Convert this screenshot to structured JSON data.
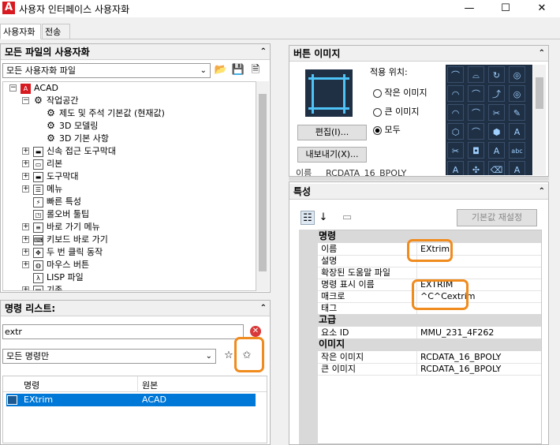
{
  "window": {
    "title": "사용자 인터페이스 사용자화",
    "logo": "A",
    "min": "—",
    "max": "☐",
    "close": "✕"
  },
  "tabs": [
    "사용자화",
    "전송"
  ],
  "all_files": {
    "header": "모든 파일의 사용자화",
    "dropdown": "모든 사용자화 파일",
    "tree": [
      {
        "label": "ACAD",
        "indent": 0,
        "icon": "acad-icon",
        "exp": "⊟"
      },
      {
        "label": "작업공간",
        "indent": 1,
        "icon": "gear-icon",
        "exp": "⊟"
      },
      {
        "label": "제도 및 주석 기본값 (현재값)",
        "indent": 2,
        "icon": "gear-icon",
        "exp": ""
      },
      {
        "label": "3D 모델링",
        "indent": 2,
        "icon": "gear-icon",
        "exp": ""
      },
      {
        "label": "3D 기본 사항",
        "indent": 2,
        "icon": "gear-icon",
        "exp": ""
      },
      {
        "label": "신속 접근 도구막대",
        "indent": 1,
        "icon": "toolbar-icon",
        "exp": "⊞"
      },
      {
        "label": "리본",
        "indent": 1,
        "icon": "ribbon-icon",
        "exp": "⊞"
      },
      {
        "label": "도구막대",
        "indent": 1,
        "icon": "toolbar-icon",
        "exp": "⊞"
      },
      {
        "label": "메뉴",
        "indent": 1,
        "icon": "menu-icon",
        "exp": "⊞"
      },
      {
        "label": "빠른 특성",
        "indent": 1,
        "icon": "quick-props-icon",
        "exp": ""
      },
      {
        "label": "롤오버 툴팁",
        "indent": 1,
        "icon": "tooltip-icon",
        "exp": ""
      },
      {
        "label": "바로 가기 메뉴",
        "indent": 1,
        "icon": "shortcut-menu-icon",
        "exp": "⊞"
      },
      {
        "label": "키보드 바로 가기",
        "indent": 1,
        "icon": "keyboard-icon",
        "exp": "⊞"
      },
      {
        "label": "두 번 클릭 동작",
        "indent": 1,
        "icon": "double-click-icon",
        "exp": "⊞"
      },
      {
        "label": "마우스 버튼",
        "indent": 1,
        "icon": "mouse-icon",
        "exp": "⊞"
      },
      {
        "label": "LISP 파일",
        "indent": 1,
        "icon": "lisp-icon",
        "exp": ""
      },
      {
        "label": "기존",
        "indent": 1,
        "icon": "legacy-icon",
        "exp": "⊞"
      }
    ]
  },
  "command_list": {
    "header": "명령 리스트:",
    "search_value": "extr",
    "filter": "모든 명령만",
    "columns": [
      "명령",
      "원본"
    ],
    "rows": [
      {
        "command": "EXtrim",
        "source": "ACAD"
      }
    ]
  },
  "button_image": {
    "header": "버튼 이미지",
    "apply_to": "적용 위치:",
    "options": [
      "작은 이미지",
      "큰 이미지",
      "모두"
    ],
    "selected": "모두",
    "edit": "편집(I)...",
    "export": "내보내기(X)...",
    "cutoff_label": "이름",
    "cutoff_value": "RCDATA_16_BPOLY"
  },
  "properties": {
    "header": "특성",
    "reset": "기본값 재설정",
    "categories": [
      {
        "name": "명령",
        "rows": [
          {
            "k": "이름",
            "v": "EXtrim"
          },
          {
            "k": "설명",
            "v": ""
          },
          {
            "k": "확장된 도움말 파일",
            "v": ""
          },
          {
            "k": "명령 표시 이름",
            "v": "EXTRIM"
          },
          {
            "k": "매크로",
            "v": "^C^Cextrim"
          },
          {
            "k": "태그",
            "v": ""
          }
        ]
      },
      {
        "name": "고급",
        "rows": [
          {
            "k": "요소 ID",
            "v": "MMU_231_4F262"
          }
        ]
      },
      {
        "name": "이미지",
        "rows": [
          {
            "k": "작은 이미지",
            "v": "RCDATA_16_BPOLY"
          },
          {
            "k": "큰 이미지",
            "v": "RCDATA_16_BPOLY"
          }
        ]
      }
    ]
  },
  "colors": {
    "selection": "#0078d7",
    "highlight": "#f08b1e",
    "acad_red": "#d71920"
  }
}
